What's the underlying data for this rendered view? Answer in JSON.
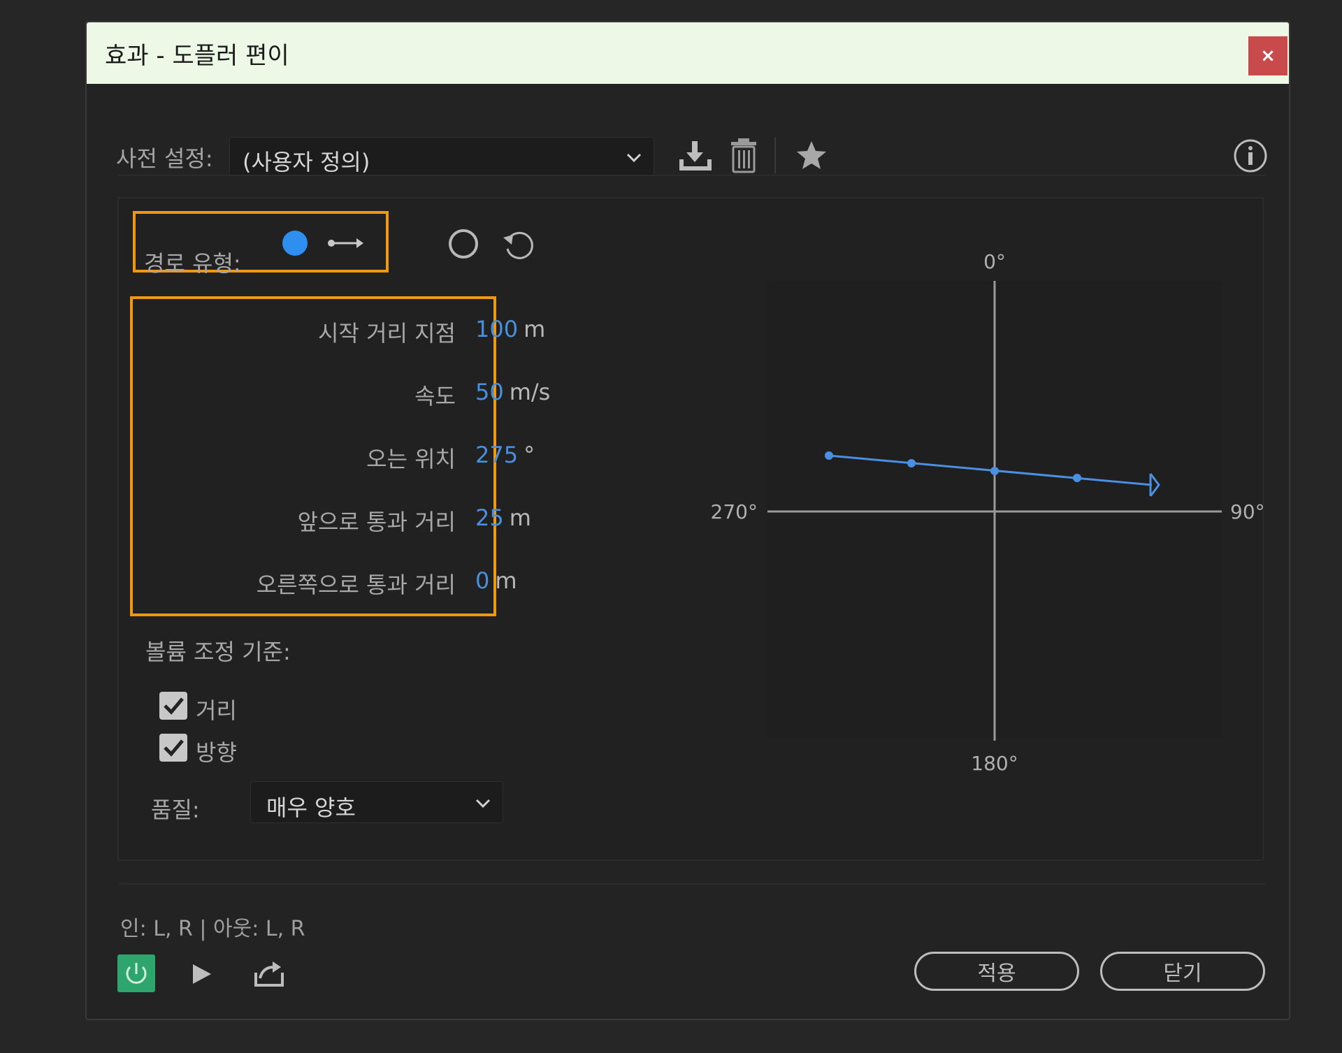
{
  "window": {
    "title": "효과 - 도플러 편이",
    "close_label": "×"
  },
  "preset": {
    "label": "사전 설정:",
    "value": "(사용자 정의)"
  },
  "path_type": {
    "label": "경로 유형:"
  },
  "params": [
    {
      "label": "시작 거리 지점",
      "value": "100",
      "unit": "m"
    },
    {
      "label": "속도",
      "value": "50",
      "unit": "m/s"
    },
    {
      "label": "오는 위치",
      "value": "275",
      "unit": "°"
    },
    {
      "label": "앞으로 통과 거리",
      "value": "25",
      "unit": "m"
    },
    {
      "label": "오른쪽으로 통과 거리",
      "value": "0",
      "unit": "m"
    }
  ],
  "graph": {
    "top": "0°",
    "right": "90°",
    "bottom": "180°",
    "left": "270°"
  },
  "volume": {
    "label": "볼륨 조정 기준:",
    "options": [
      {
        "label": "거리",
        "checked": true
      },
      {
        "label": "방향",
        "checked": true
      }
    ]
  },
  "quality": {
    "label": "품질:",
    "value": "매우 양호"
  },
  "io": {
    "text": "인: L, R | 아웃: L, R"
  },
  "buttons": {
    "apply": "적용",
    "close": "닫기"
  },
  "colors": {
    "accent": "#4790de",
    "highlight": "#f09812",
    "power": "#2ea56c",
    "title_bg": "#edf8e7",
    "close": "#c84a4a"
  },
  "icons": [
    "save-preset-icon",
    "delete-preset-icon",
    "favorite-star-icon",
    "info-icon",
    "path-straight-icon",
    "path-circle-icon",
    "path-rotate-icon",
    "power-icon",
    "play-icon",
    "export-icon"
  ]
}
